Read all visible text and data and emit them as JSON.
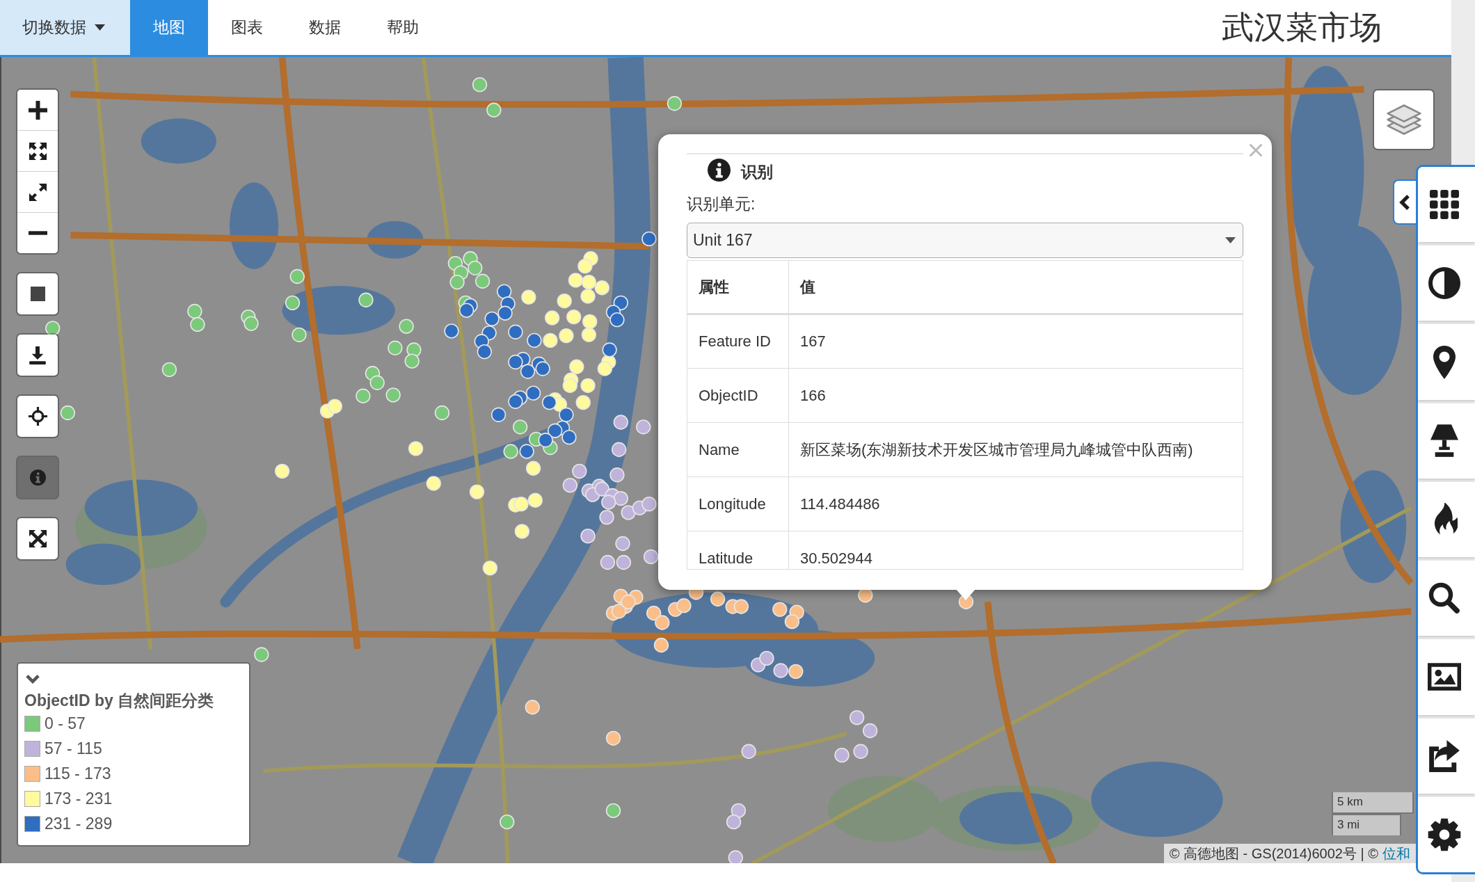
{
  "navbar": {
    "data_menu": {
      "label": "切换数据"
    },
    "tabs": [
      {
        "label": "地图",
        "selected": true
      },
      {
        "label": "图表",
        "selected": false
      },
      {
        "label": "数据",
        "selected": false
      },
      {
        "label": "帮助",
        "selected": false
      }
    ],
    "title": "武汉菜市场"
  },
  "map_tools": [
    {
      "kind": "square",
      "selected": false
    },
    {
      "kind": "download",
      "selected": false
    },
    {
      "kind": "locate",
      "selected": false
    },
    {
      "kind": "identify",
      "selected": true
    },
    {
      "kind": "fullscreen",
      "selected": false
    }
  ],
  "popup": {
    "title": "识别",
    "unit_label": "识别单元:",
    "unit_select": {
      "value": "Unit 167"
    },
    "table": {
      "columns": [
        "属性",
        "值"
      ],
      "rows": [
        [
          "Feature ID",
          "167"
        ],
        [
          "ObjectID",
          "166"
        ],
        [
          "Name",
          "新区菜场(东湖新技术开发区城市管理局九峰城管中队西南)"
        ],
        [
          "Longitude",
          "114.484486"
        ],
        [
          "Latitude",
          "30.502944"
        ]
      ]
    }
  },
  "legend": {
    "expanded": true,
    "title": "ObjectID by 自然间距分类",
    "classes": [
      {
        "label": "0 - 57",
        "color": "#7bc97b"
      },
      {
        "label": "57 - 115",
        "color": "#bfb3db"
      },
      {
        "label": "115 - 173",
        "color": "#fbbe88"
      },
      {
        "label": "173 - 231",
        "color": "#fffa9c"
      },
      {
        "label": "231 - 289",
        "color": "#2f6dc0"
      }
    ]
  },
  "scale": {
    "metric": "5 km",
    "imperial": "3 mi"
  },
  "attribution": {
    "text": "© 高德地图 - GS(2014)6002号 | ©",
    "link": "位和"
  }
}
